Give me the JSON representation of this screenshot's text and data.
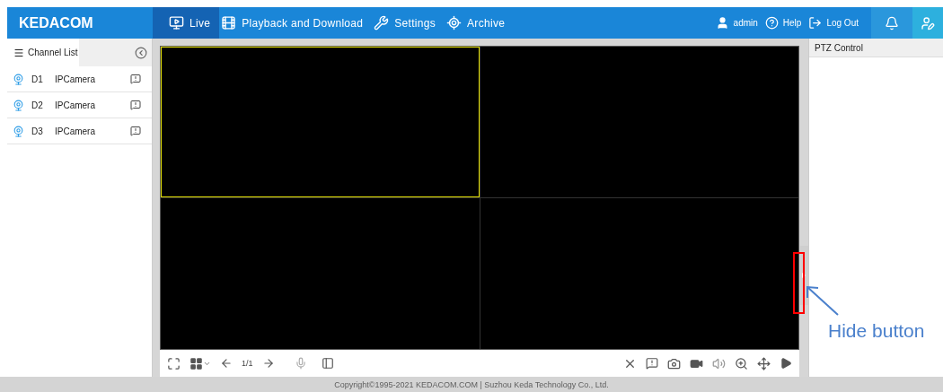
{
  "header": {
    "logo": "KEDACOM",
    "nav": [
      {
        "label": "Live",
        "selected": true
      },
      {
        "label": "Playback and Download",
        "selected": false
      },
      {
        "label": "Settings",
        "selected": false
      },
      {
        "label": "Archive",
        "selected": false
      }
    ],
    "user": "admin",
    "help": "Help",
    "logout": "Log Out"
  },
  "sidebar": {
    "title": "Channel List",
    "channels": [
      {
        "id": "D1",
        "name": "IPCamera"
      },
      {
        "id": "D2",
        "name": "IPCamera"
      },
      {
        "id": "D3",
        "name": "IPCamera"
      }
    ]
  },
  "video": {
    "cells": [
      {
        "selected": true
      },
      {
        "selected": false
      },
      {
        "selected": false
      },
      {
        "selected": false
      }
    ],
    "page": "1/1"
  },
  "ptz": {
    "title": "PTZ Control"
  },
  "annotation": {
    "label": "Hide button"
  },
  "footer": "Copyright©1995-2021 KEDACOM.COM | Suzhou Keda Technology Co., Ltd."
}
